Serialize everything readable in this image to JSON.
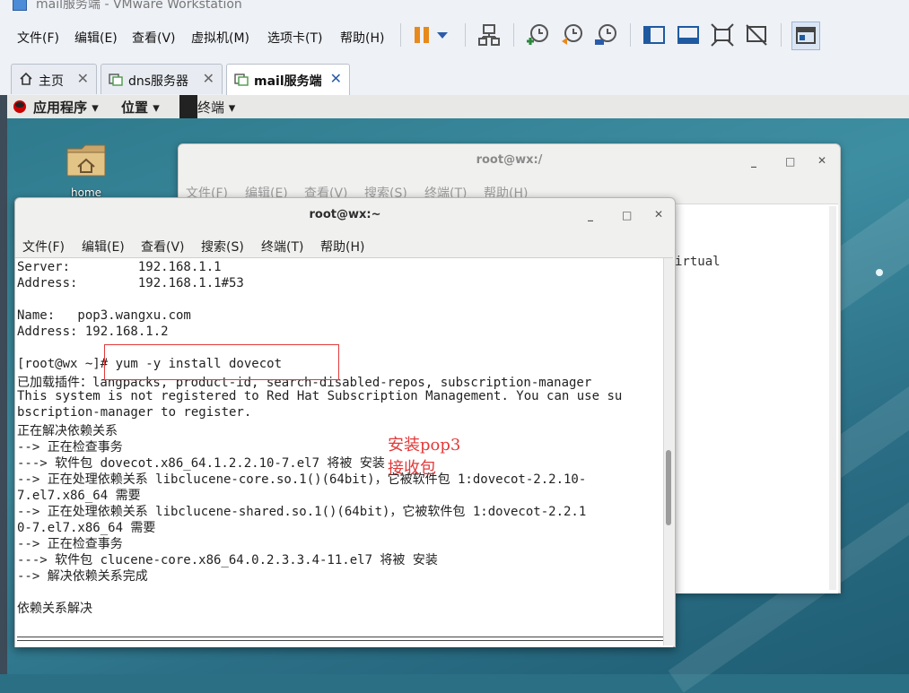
{
  "vmware": {
    "title": "mail服务端 - VMware Workstation",
    "menu": [
      "文件(F)",
      "编辑(E)",
      "查看(V)",
      "虚拟机(M)",
      "选项卡(T)",
      "帮助(H)"
    ],
    "toolbar_icons": [
      "pause-icon",
      "dropdown-icon",
      "network-icon",
      "snapshot-take-icon",
      "snapshot-revert-icon",
      "snapshot-manager-icon",
      "sidebar-icon",
      "console-view-icon",
      "fullscreen-icon",
      "unity-icon",
      "thumbnail-icon"
    ],
    "tabs": [
      {
        "label": "主页",
        "icon": "home-icon"
      },
      {
        "label": "dns服务器",
        "icon": "vm-icon"
      },
      {
        "label": "mail服务端",
        "icon": "vm-icon",
        "active": true
      }
    ]
  },
  "gnome": {
    "applications": "应用程序",
    "places": "位置",
    "terminal": "终端",
    "desktop_icon_label": "home"
  },
  "back_window": {
    "title": "root@wx:/",
    "menu": [
      "文件(F)",
      "编辑(E)",
      "查看(V)",
      "搜索(S)",
      "终端(T)",
      "帮助(H)"
    ],
    "fragment": "irtual"
  },
  "front_window": {
    "title": "root@wx:~",
    "menu": [
      "文件(F)",
      "编辑(E)",
      "查看(V)",
      "搜索(S)",
      "终端(T)",
      "帮助(H)"
    ],
    "lines": [
      "Server:         192.168.1.1",
      "Address:        192.168.1.1#53",
      "",
      "Name:   pop3.wangxu.com",
      "Address: 192.168.1.2",
      "",
      "[root@wx ~]# yum -y install dovecot",
      "已加载插件：langpacks, product-id, search-disabled-repos, subscription-manager",
      "This system is not registered to Red Hat Subscription Management. You can use su",
      "bscription-manager to register.",
      "正在解决依赖关系",
      "--> 正在检查事务",
      "---> 软件包 dovecot.x86_64.1.2.2.10-7.el7 将被 安装",
      "--> 正在处理依赖关系 libclucene-core.so.1()(64bit)，它被软件包 1:dovecot-2.2.10-",
      "7.el7.x86_64 需要",
      "--> 正在处理依赖关系 libclucene-shared.so.1()(64bit)，它被软件包 1:dovecot-2.2.1",
      "0-7.el7.x86_64 需要",
      "--> 正在检查事务",
      "---> 软件包 clucene-core.x86_64.0.2.3.3.4-11.el7 将被 安装",
      "--> 解决依赖关系完成",
      "",
      "依赖关系解决"
    ],
    "annotation_1": "安装pop3",
    "annotation_2": "接收包"
  }
}
